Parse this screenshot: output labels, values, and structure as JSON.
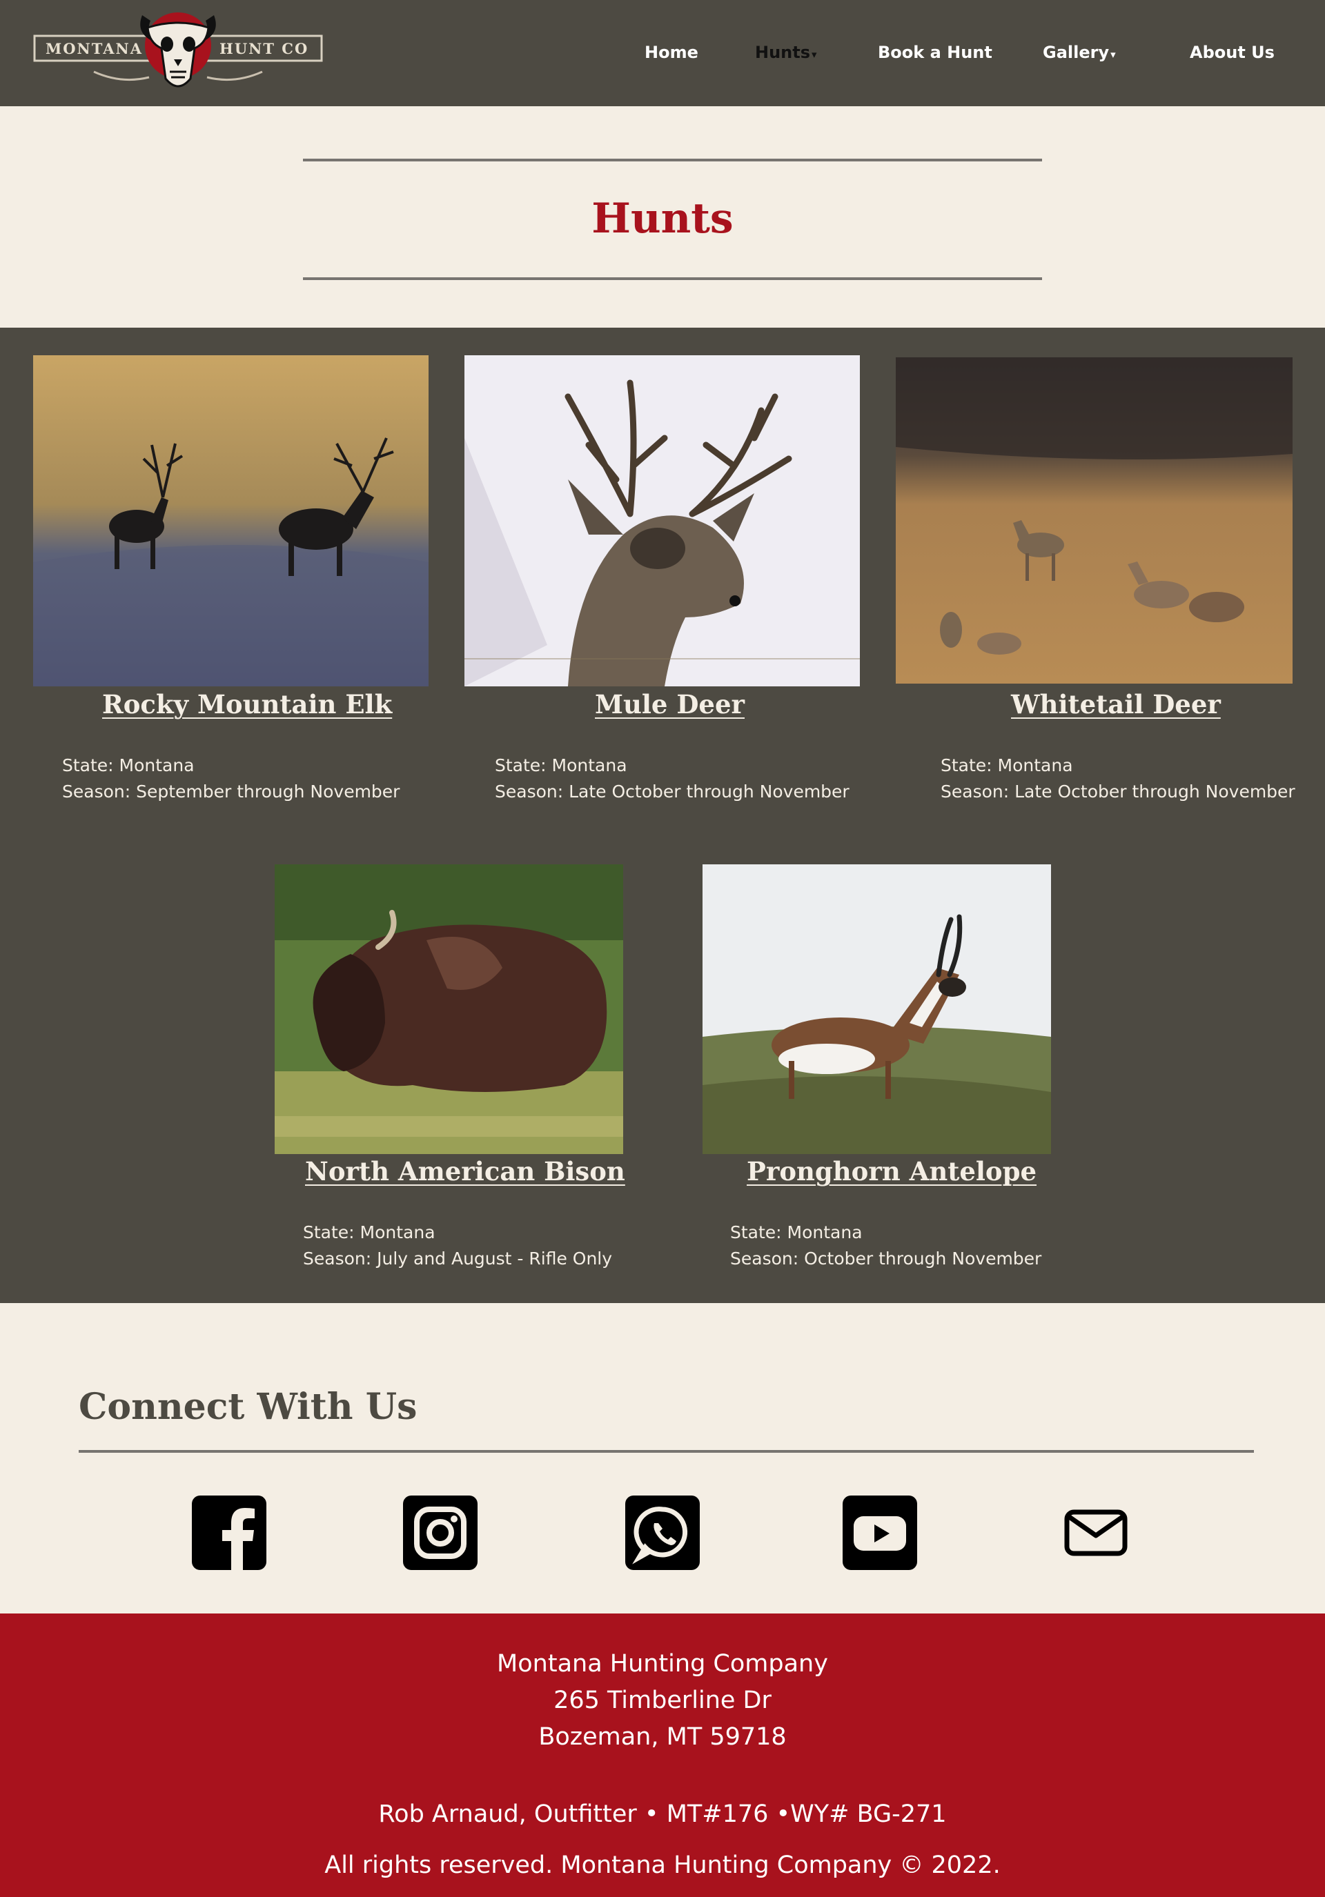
{
  "brand": {
    "logo_word_left": "MONTANA",
    "logo_word_right": "HUNT CO",
    "colors": {
      "header_bg": "#4d4a42",
      "accent_red": "#a8121d",
      "cream": "#f4eee4"
    }
  },
  "nav": {
    "items": [
      {
        "label": "Home",
        "has_caret": false,
        "active": false
      },
      {
        "label": "Hunts",
        "has_caret": true,
        "active": true
      },
      {
        "label": "Book a Hunt",
        "has_caret": false,
        "active": false
      },
      {
        "label": "Gallery",
        "has_caret": true,
        "active": false
      },
      {
        "label": "About Us",
        "has_caret": false,
        "active": false
      }
    ],
    "caret_glyph": "▾"
  },
  "page": {
    "title": "Hunts"
  },
  "hunts": [
    {
      "name": "Rocky Mountain Elk",
      "state": "State: Montana",
      "season": "Season: September through November",
      "image": "elk-photo"
    },
    {
      "name": "Mule Deer",
      "state": "State: Montana",
      "season": "Season: Late October through November",
      "image": "mule-deer-photo"
    },
    {
      "name": "Whitetail Deer",
      "state": "State: Montana",
      "season": "Season: Late October through November",
      "image": "whitetail-deer-photo"
    },
    {
      "name": "North American Bison",
      "state": "State: Montana",
      "season": "Season: July and August - Rifle Only",
      "image": "bison-photo"
    },
    {
      "name": "Pronghorn Antelope",
      "state": "State: Montana",
      "season": "Season: October through November",
      "image": "pronghorn-photo"
    }
  ],
  "connect": {
    "title": "Connect With Us",
    "icons": [
      "facebook-icon",
      "instagram-icon",
      "whatsapp-icon",
      "youtube-icon",
      "mail-icon"
    ]
  },
  "footer": {
    "company": "Montana Hunting Company",
    "street": "265 Timberline Dr",
    "city": "Bozeman, MT 59718",
    "outfitter": "Rob Arnaud, Outfitter • MT#176 •WY# BG-271",
    "copyright": "All rights reserved. Montana Hunting Company © 2022."
  }
}
